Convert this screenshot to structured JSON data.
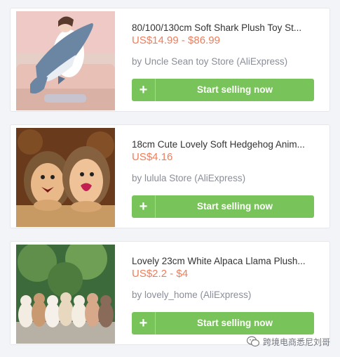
{
  "products": [
    {
      "title": "80/100/130cm Soft Shark Plush Toy St...",
      "price": "US$14.99 - $86.99",
      "store": "by Uncle Sean toy Store (AliExpress)",
      "button_label": "Start selling now",
      "button_icon": "+",
      "image": "shark-plush-photo"
    },
    {
      "title": "18cm Cute Lovely Soft Hedgehog Anim...",
      "price": "US$4.16",
      "store": "by lulula Store (AliExpress)",
      "button_label": "Start selling now",
      "button_icon": "+",
      "image": "hedgehog-plush-photo"
    },
    {
      "title": "Lovely 23cm White Alpaca Llama Plush...",
      "price": "US$2.2 - $4",
      "store": "by lovely_home (AliExpress)",
      "button_label": "Start selling now",
      "button_icon": "+",
      "image": "alpaca-plush-photo"
    }
  ],
  "watermark": {
    "text": "跨境电商悉尼刘哥",
    "icon": "wechat-icon"
  },
  "colors": {
    "price": "#ef7d5b",
    "button": "#79c45a",
    "store_text": "#8a8e99",
    "title_text": "#333333"
  }
}
